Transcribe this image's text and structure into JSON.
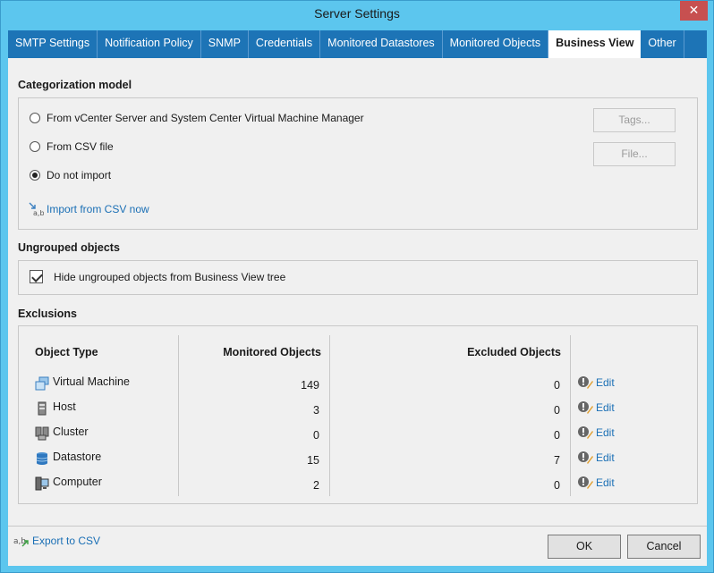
{
  "window": {
    "title": "Server Settings",
    "close_label": "✕"
  },
  "tabs": [
    {
      "label": "SMTP Settings",
      "active": false
    },
    {
      "label": "Notification Policy",
      "active": false
    },
    {
      "label": "SNMP",
      "active": false
    },
    {
      "label": "Credentials",
      "active": false
    },
    {
      "label": "Monitored Datastores",
      "active": false
    },
    {
      "label": "Monitored Objects",
      "active": false
    },
    {
      "label": "Business View",
      "active": true
    },
    {
      "label": "Other",
      "active": false
    }
  ],
  "categorization": {
    "title": "Categorization model",
    "options": [
      {
        "label": "From vCenter Server and System Center Virtual Machine Manager",
        "checked": false
      },
      {
        "label": "From CSV file",
        "checked": false
      },
      {
        "label": "Do not import",
        "checked": true
      }
    ],
    "tags_button": "Tags...",
    "file_button": "File...",
    "import_link": "Import from CSV now",
    "import_icon_text": "a,b"
  },
  "ungrouped": {
    "title": "Ungrouped objects",
    "checkbox_label": "Hide ungrouped objects from Business View tree",
    "checked": true
  },
  "exclusions": {
    "title": "Exclusions",
    "headers": {
      "type": "Object Type",
      "monitored": "Monitored Objects",
      "excluded": "Excluded Objects"
    },
    "rows": [
      {
        "type": "Virtual Machine",
        "icon": "virtual-machine-icon",
        "monitored": "149",
        "excluded": "0",
        "action": "Edit"
      },
      {
        "type": "Host",
        "icon": "host-icon",
        "monitored": "3",
        "excluded": "0",
        "action": "Edit"
      },
      {
        "type": "Cluster",
        "icon": "cluster-icon",
        "monitored": "0",
        "excluded": "0",
        "action": "Edit"
      },
      {
        "type": "Datastore",
        "icon": "datastore-icon",
        "monitored": "15",
        "excluded": "7",
        "action": "Edit"
      },
      {
        "type": "Computer",
        "icon": "computer-icon",
        "monitored": "2",
        "excluded": "0",
        "action": "Edit"
      }
    ]
  },
  "footer": {
    "export_link": "Export to CSV",
    "export_icon_text": "a,b",
    "ok": "OK",
    "cancel": "Cancel"
  },
  "colors": {
    "title_bar": "#5cc6ee",
    "tab_bar": "#1d74b6",
    "link": "#1a6fb5",
    "close": "#c75050"
  }
}
